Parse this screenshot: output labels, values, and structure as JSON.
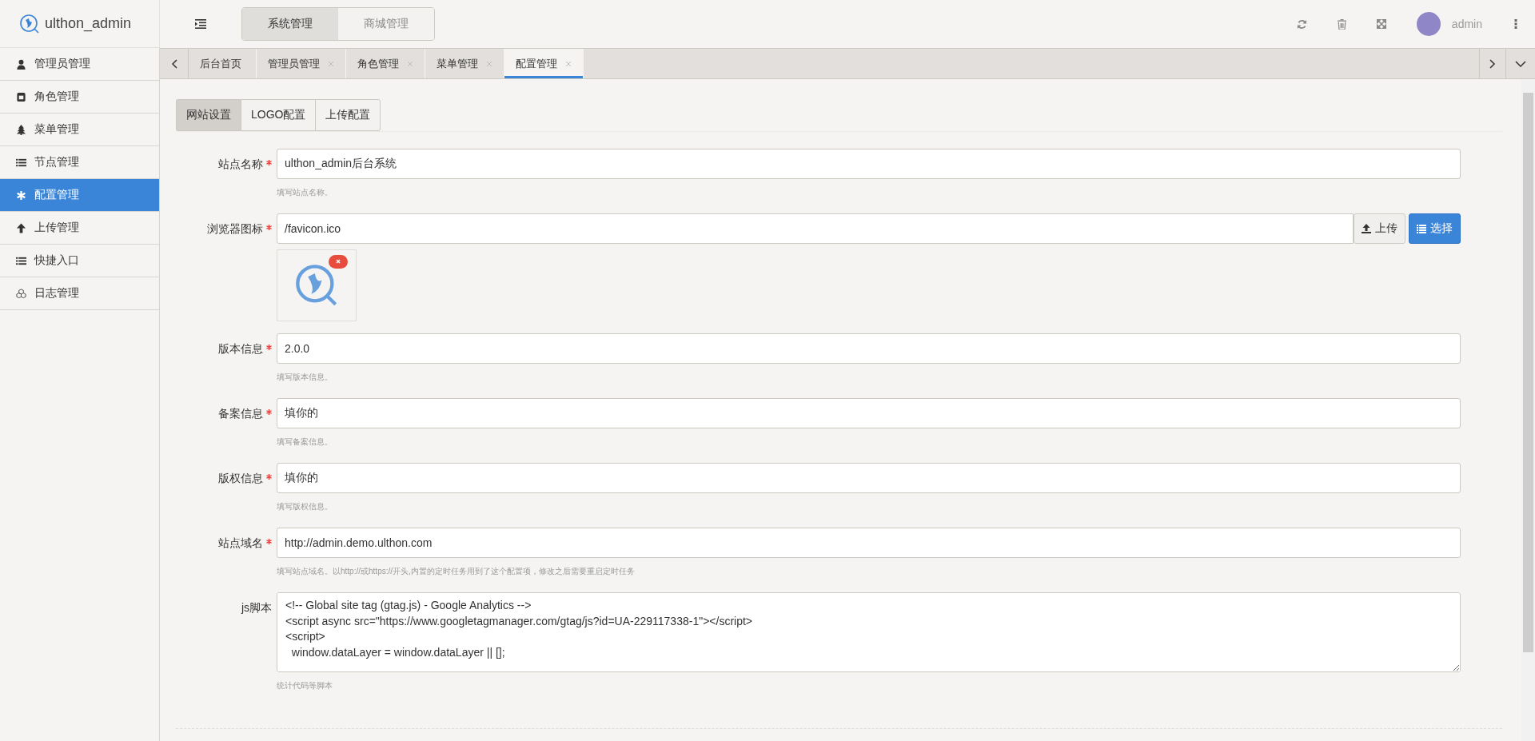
{
  "brand": {
    "name": "ulthon_admin"
  },
  "modules": [
    {
      "label": "系统管理",
      "selected": true
    },
    {
      "label": "商城管理",
      "selected": false
    }
  ],
  "user": {
    "name": "admin"
  },
  "sidebar": {
    "items": [
      {
        "label": "管理员管理",
        "kind": "user",
        "selected": false
      },
      {
        "label": "角色管理",
        "kind": "badge",
        "selected": false
      },
      {
        "label": "菜单管理",
        "kind": "tree",
        "selected": false
      },
      {
        "label": "节点管理",
        "kind": "list",
        "selected": false
      },
      {
        "label": "配置管理",
        "kind": "asterisk",
        "selected": true
      },
      {
        "label": "上传管理",
        "kind": "up",
        "selected": false
      },
      {
        "label": "快捷入口",
        "kind": "list",
        "selected": false
      },
      {
        "label": "日志管理",
        "kind": "cubes",
        "selected": false
      }
    ]
  },
  "page_tabs": [
    {
      "label": "后台首页",
      "closable": false,
      "selected": false
    },
    {
      "label": "管理员管理",
      "closable": true,
      "selected": false
    },
    {
      "label": "角色管理",
      "closable": true,
      "selected": false
    },
    {
      "label": "菜单管理",
      "closable": true,
      "selected": false
    },
    {
      "label": "配置管理",
      "closable": true,
      "selected": true
    }
  ],
  "config_tabs": [
    {
      "label": "网站设置",
      "selected": true
    },
    {
      "label": "LOGO配置",
      "selected": false
    },
    {
      "label": "上传配置",
      "selected": false
    }
  ],
  "form": {
    "fields": [
      {
        "kind": "text",
        "label": "站点名称",
        "required": true,
        "value": "ulthon_admin后台系统",
        "hint": "填写站点名称。"
      },
      {
        "kind": "file",
        "label": "浏览器图标",
        "required": true,
        "value": "/favicon.ico",
        "upload_button": "上传",
        "choose_button": "选择"
      },
      {
        "kind": "text",
        "label": "版本信息",
        "required": true,
        "value": "2.0.0",
        "hint": "填写版本信息。"
      },
      {
        "kind": "text",
        "label": "备案信息",
        "required": true,
        "value": "填你的",
        "hint": "填写备案信息。"
      },
      {
        "kind": "text",
        "label": "版权信息",
        "required": true,
        "value": "填你的",
        "hint": "填写版权信息。"
      },
      {
        "kind": "text",
        "label": "站点域名",
        "required": true,
        "value": "http://admin.demo.ulthon.com",
        "hint": "填写站点域名。以http://或https://开头,内置的定时任务用到了这个配置项，修改之后需要重启定时任务"
      },
      {
        "kind": "textarea",
        "label": "js脚本",
        "required": false,
        "value": "<!-- Global site tag (gtag.js) - Google Analytics -->\n<script async src=\"https://www.googletagmanager.com/gtag/js?id=UA-229117338-1\"></script>\n<script>\n  window.dataLayer = window.dataLayer || [];",
        "hint": "统计代码等脚本"
      }
    ]
  }
}
